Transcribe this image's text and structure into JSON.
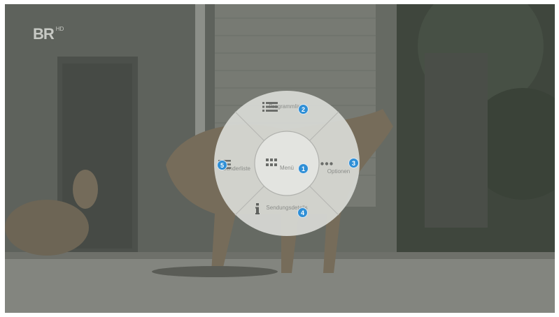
{
  "channel": {
    "logo_text": "BR",
    "hd_badge": "HD"
  },
  "menu": {
    "center": {
      "label": "Menü",
      "badge": "1",
      "icon": "grid-icon"
    },
    "top": {
      "label": "Programmliste",
      "badge": "2",
      "icon": "list-icon"
    },
    "right": {
      "label": "Optionen",
      "badge": "3",
      "icon": "more-dots-icon"
    },
    "bottom": {
      "label": "Sendungsdetails",
      "badge": "4",
      "icon": "info-icon"
    },
    "left": {
      "label": "Senderliste",
      "badge": "5",
      "icon": "hamburger-list-icon"
    }
  },
  "colors": {
    "badge_blue": "#2f8fd6",
    "menu_bg": "#d9dad6",
    "overlay": "#5b5e59"
  }
}
